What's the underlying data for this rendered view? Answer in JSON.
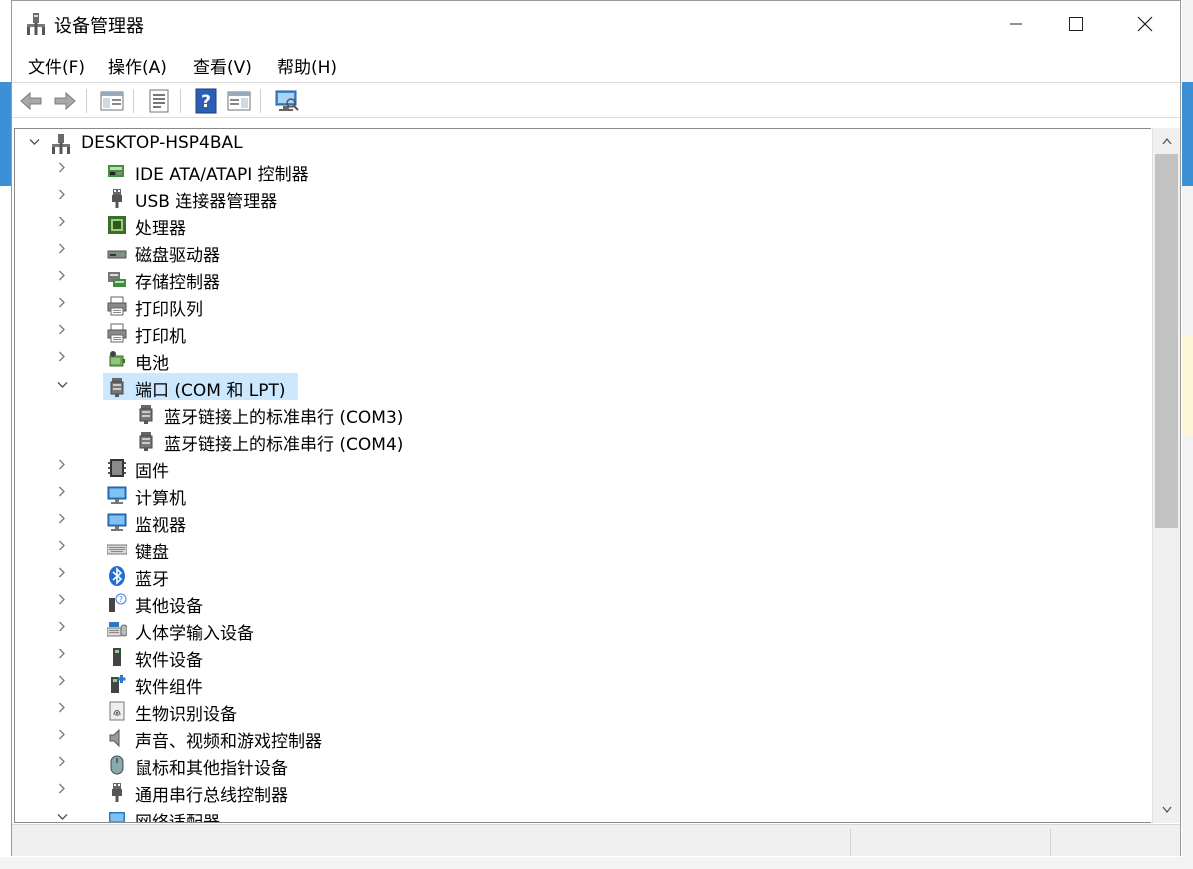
{
  "window": {
    "title": "设备管理器",
    "controls": {
      "minimize": "—",
      "maximize": "☐",
      "close": "✕"
    }
  },
  "menu": [
    "文件(F)",
    "操作(A)",
    "查看(V)",
    "帮助(H)"
  ],
  "toolbar": [
    "back-icon",
    "forward-icon",
    "show-hide-tree-icon",
    "properties-icon",
    "help-icon",
    "action-pane-icon",
    "scan-hardware-icon"
  ],
  "tree": {
    "root": {
      "label": "DESKTOP-HSP4BAL",
      "expanded": true,
      "icon": "computer-network-icon"
    },
    "items": [
      {
        "label": "IDE ATA/ATAPI 控制器",
        "icon": "ide-controller-icon",
        "expanded": false
      },
      {
        "label": "USB 连接器管理器",
        "icon": "usb-connector-icon",
        "expanded": false
      },
      {
        "label": "处理器",
        "icon": "processor-icon",
        "expanded": false
      },
      {
        "label": "磁盘驱动器",
        "icon": "disk-drive-icon",
        "expanded": false
      },
      {
        "label": "存储控制器",
        "icon": "storage-controller-icon",
        "expanded": false
      },
      {
        "label": "打印队列",
        "icon": "print-queue-icon",
        "expanded": false
      },
      {
        "label": "打印机",
        "icon": "printer-icon",
        "expanded": false
      },
      {
        "label": "电池",
        "icon": "battery-icon",
        "expanded": false
      },
      {
        "label": "端口 (COM 和 LPT)",
        "icon": "port-icon",
        "expanded": true,
        "selected": true,
        "children": [
          {
            "label": "蓝牙链接上的标准串行 (COM3)",
            "icon": "port-icon"
          },
          {
            "label": "蓝牙链接上的标准串行 (COM4)",
            "icon": "port-icon"
          }
        ]
      },
      {
        "label": "固件",
        "icon": "firmware-icon",
        "expanded": false
      },
      {
        "label": "计算机",
        "icon": "computer-icon",
        "expanded": false
      },
      {
        "label": "监视器",
        "icon": "monitor-icon",
        "expanded": false
      },
      {
        "label": "键盘",
        "icon": "keyboard-icon",
        "expanded": false
      },
      {
        "label": "蓝牙",
        "icon": "bluetooth-icon",
        "expanded": false
      },
      {
        "label": "其他设备",
        "icon": "other-devices-icon",
        "expanded": false
      },
      {
        "label": "人体学输入设备",
        "icon": "hid-icon",
        "expanded": false
      },
      {
        "label": "软件设备",
        "icon": "software-device-icon",
        "expanded": false
      },
      {
        "label": "软件组件",
        "icon": "software-component-icon",
        "expanded": false
      },
      {
        "label": "生物识别设备",
        "icon": "biometric-icon",
        "expanded": false
      },
      {
        "label": "声音、视频和游戏控制器",
        "icon": "sound-icon",
        "expanded": false
      },
      {
        "label": "鼠标和其他指针设备",
        "icon": "mouse-icon",
        "expanded": false
      },
      {
        "label": "通用串行总线控制器",
        "icon": "usb-controller-icon",
        "expanded": false
      },
      {
        "label": "网络适配器",
        "icon": "network-adapter-icon",
        "expanded": true
      }
    ]
  },
  "status_bar": {
    "panes": [
      "",
      "",
      ""
    ]
  }
}
